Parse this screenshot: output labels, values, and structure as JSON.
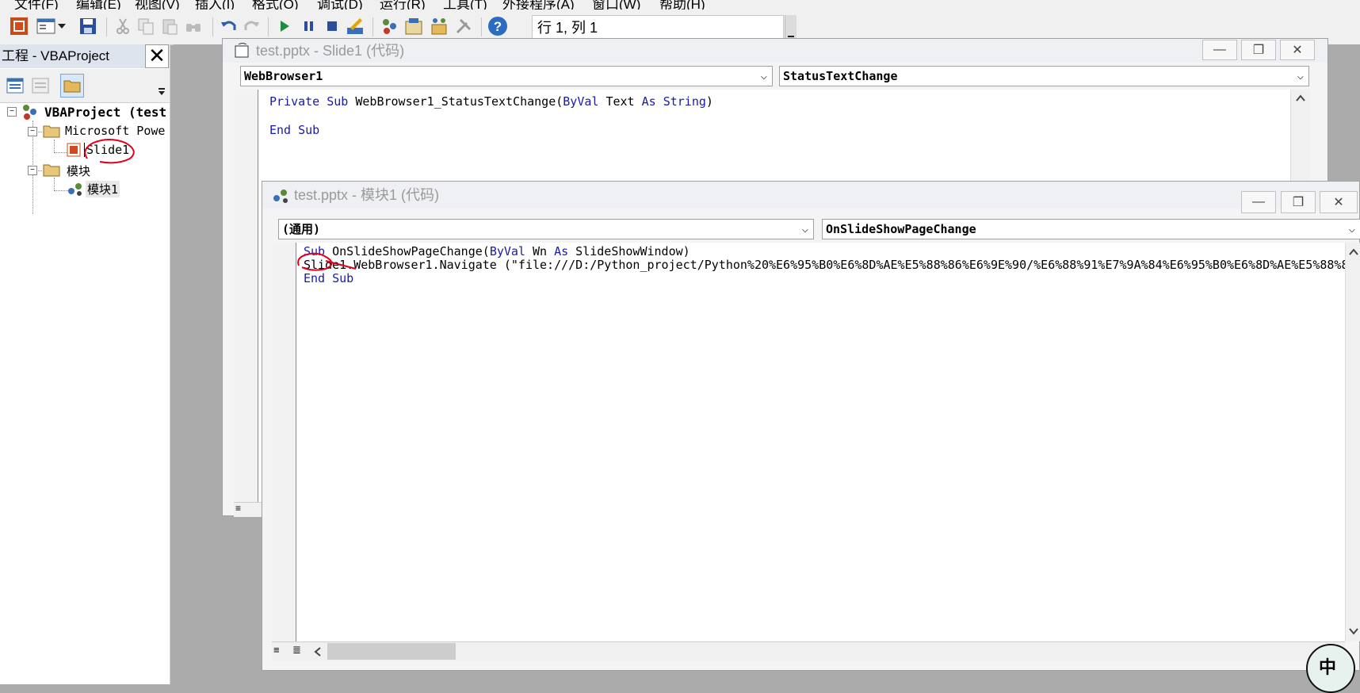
{
  "menu": [
    "文件(F)",
    "编辑(E)",
    "视图(V)",
    "插入(I)",
    "格式(O)",
    "调试(D)",
    "运行(R)",
    "工具(T)",
    "外接程序(A)",
    "窗口(W)",
    "帮助(H)"
  ],
  "toolbar": {
    "status": "行 1, 列 1",
    "icons": [
      "powerpoint-icon",
      "userform-icon",
      "dropdown-arrow-icon",
      "save-icon",
      "cut-icon",
      "copy-icon",
      "paste-icon",
      "find-icon",
      "undo-icon",
      "redo-icon",
      "run-icon",
      "break-icon",
      "reset-icon",
      "design-mode-icon",
      "project-explorer-icon",
      "properties-icon",
      "object-browser-icon",
      "toolbox-icon",
      "help-icon"
    ]
  },
  "project": {
    "title": "工程 - VBAProject",
    "tree": {
      "root": "VBAProject (test",
      "folder1": "Microsoft Powe",
      "slide": "Slide1",
      "folder2": "模块",
      "module": "模块1"
    }
  },
  "win1": {
    "title": "test.pptx - Slide1 (代码)",
    "object": "WebBrowser1",
    "procedure": "StatusTextChange",
    "code": {
      "l1_a": "Private Sub ",
      "l1_b": "WebBrowser1_StatusTextChange(",
      "l1_c": "ByVal",
      "l1_d": " Text ",
      "l1_e": "As String",
      "l1_f": ")",
      "l2": "End Sub"
    }
  },
  "win2": {
    "title": "test.pptx - 模块1 (代码)",
    "object": "(通用)",
    "procedure": "OnSlideShowPageChange",
    "code": {
      "l1_a": "Sub",
      "l1_b": " OnSlideShowPageChange(",
      "l1_c": "ByVal",
      "l1_d": " Wn ",
      "l1_e": "As",
      "l1_f": " SlideShowWindow)",
      "l2": "Slide1.WebBrowser1.Navigate (\"file:///D:/Python_project/Python%20%E6%95%B0%E6%8D%AE%E5%88%86%E6%9E%90/%E6%88%91%E7%9A%84%E6%95%B0%E6%8D%AE%E5%88%86%",
      "l3": "End Sub"
    }
  },
  "ime": {
    "label": "中"
  }
}
